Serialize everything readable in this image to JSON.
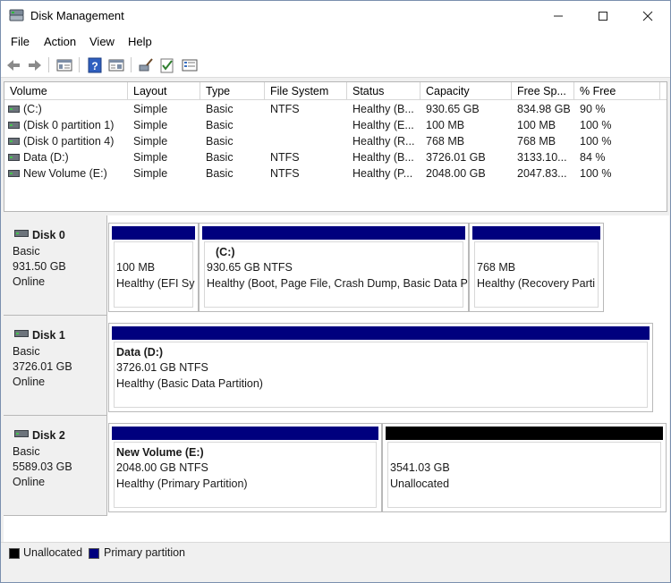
{
  "window": {
    "title": "Disk Management"
  },
  "menu": {
    "file": "File",
    "action": "Action",
    "view": "View",
    "help": "Help"
  },
  "toolbar": {
    "icons": [
      "back-arrow-icon",
      "forward-arrow-icon",
      "disk-view-icon",
      "help-icon",
      "properties-icon",
      "rescan-icon",
      "check-icon",
      "console-icon"
    ]
  },
  "volumes": {
    "columns": [
      "Volume",
      "Layout",
      "Type",
      "File System",
      "Status",
      "Capacity",
      "Free Sp...",
      "% Free"
    ],
    "rows": [
      {
        "volume": "(C:)",
        "layout": "Simple",
        "type": "Basic",
        "fs": "NTFS",
        "status": "Healthy (B...",
        "capacity": "930.65 GB",
        "free": "834.98 GB",
        "pct": "90 %"
      },
      {
        "volume": "(Disk 0 partition 1)",
        "layout": "Simple",
        "type": "Basic",
        "fs": "",
        "status": "Healthy (E...",
        "capacity": "100 MB",
        "free": "100 MB",
        "pct": "100 %"
      },
      {
        "volume": "(Disk 0 partition 4)",
        "layout": "Simple",
        "type": "Basic",
        "fs": "",
        "status": "Healthy (R...",
        "capacity": "768 MB",
        "free": "768 MB",
        "pct": "100 %"
      },
      {
        "volume": "Data (D:)",
        "layout": "Simple",
        "type": "Basic",
        "fs": "NTFS",
        "status": "Healthy (B...",
        "capacity": "3726.01 GB",
        "free": "3133.10...",
        "pct": "84 %"
      },
      {
        "volume": "New Volume (E:)",
        "layout": "Simple",
        "type": "Basic",
        "fs": "NTFS",
        "status": "Healthy (P...",
        "capacity": "2048.00 GB",
        "free": "2047.83...",
        "pct": "100 %"
      }
    ]
  },
  "disks": [
    {
      "name": "Disk 0",
      "type": "Basic",
      "size": "931.50 GB",
      "state": "Online",
      "partitions": [
        {
          "title": "",
          "size": "100 MB",
          "status": "Healthy (EFI Sy"
        },
        {
          "title": "(C:)",
          "size": "930.65 GB NTFS",
          "status": "Healthy (Boot, Page File, Crash Dump, Basic Data P"
        },
        {
          "title": "",
          "size": "768 MB",
          "status": "Healthy (Recovery Parti"
        }
      ]
    },
    {
      "name": "Disk 1",
      "type": "Basic",
      "size": "3726.01 GB",
      "state": "Online",
      "partitions": [
        {
          "title": "Data  (D:)",
          "size": "3726.01 GB NTFS",
          "status": "Healthy (Basic Data Partition)"
        }
      ]
    },
    {
      "name": "Disk 2",
      "type": "Basic",
      "size": "5589.03 GB",
      "state": "Online",
      "partitions": [
        {
          "title": "New Volume  (E:)",
          "size": "2048.00 GB NTFS",
          "status": "Healthy (Primary Partition)"
        },
        {
          "title": "",
          "size": "3541.03 GB",
          "status": "Unallocated"
        }
      ]
    }
  ],
  "legend": {
    "unallocated": "Unallocated",
    "primary": "Primary partition"
  },
  "colors": {
    "primary": "#00007e",
    "unallocated": "#000000"
  }
}
